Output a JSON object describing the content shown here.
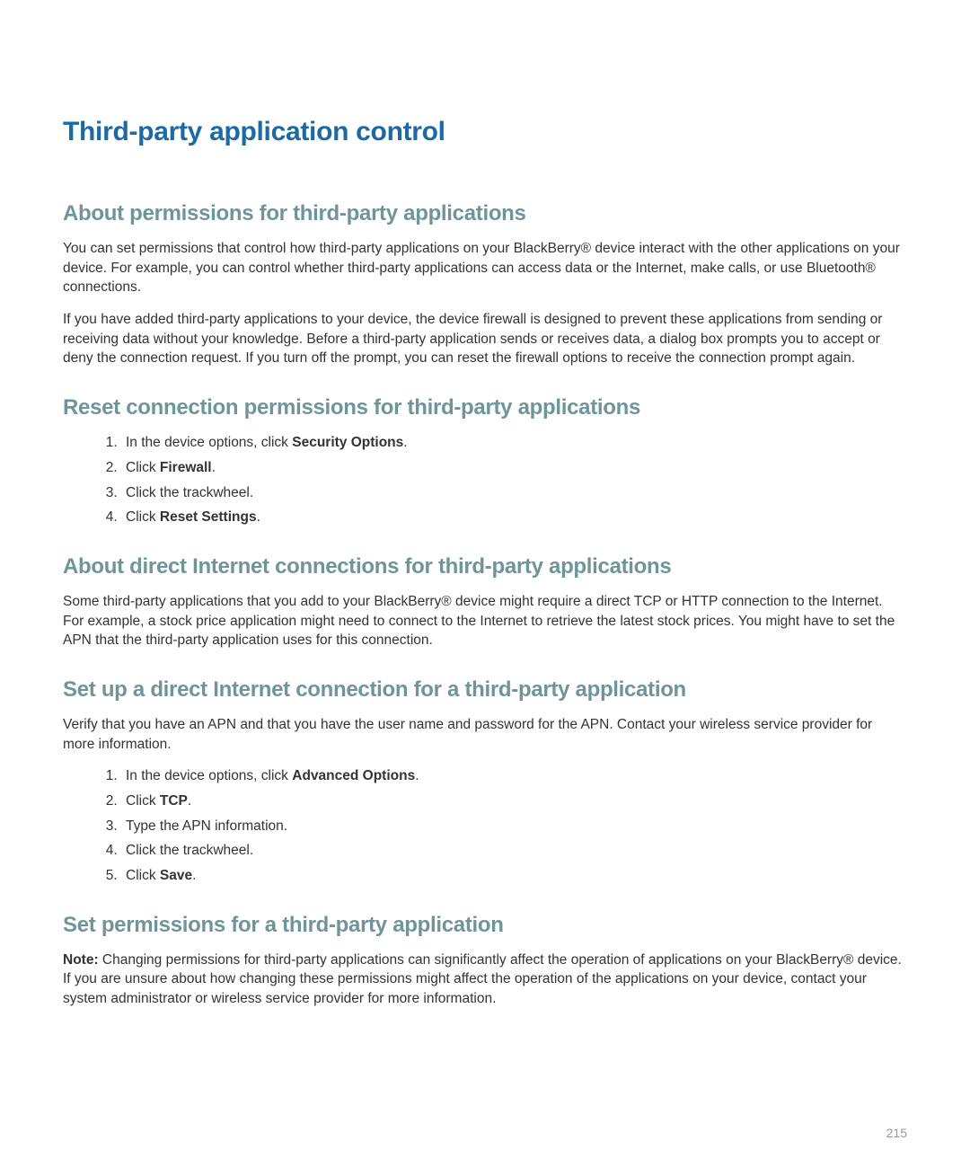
{
  "page": {
    "title": "Third-party application control",
    "pageNumber": "215"
  },
  "section1": {
    "heading": "About permissions for third-party applications",
    "para1": "You can set permissions that control how third-party applications on your BlackBerry® device interact with the other applications on your device. For example, you can control whether third-party applications can access data or the Internet, make calls, or use Bluetooth® connections.",
    "para2": "If you have added third-party applications to your device, the device firewall is designed to prevent these applications from sending or receiving data without your knowledge. Before a third-party application sends or receives data, a dialog box prompts you to accept or deny the connection request. If you turn off the prompt, you can reset the firewall options to receive the connection prompt again."
  },
  "section2": {
    "heading": "Reset connection permissions for third-party applications",
    "steps": [
      {
        "pre": "In the device options, click ",
        "bold": "Security Options",
        "post": "."
      },
      {
        "pre": "Click ",
        "bold": "Firewall",
        "post": "."
      },
      {
        "pre": "Click the trackwheel.",
        "bold": "",
        "post": ""
      },
      {
        "pre": "Click ",
        "bold": "Reset Settings",
        "post": "."
      }
    ]
  },
  "section3": {
    "heading": "About direct Internet connections for third-party applications",
    "para1": "Some third-party applications that you add to your BlackBerry® device might require a direct TCP or HTTP connection to the Internet. For example, a stock price application might need to connect to the Internet to retrieve the latest stock prices. You might have to set the APN that the third-party application uses for this connection."
  },
  "section4": {
    "heading": "Set up a direct Internet connection for a third-party application",
    "intro": "Verify that you have an APN and that you have the user name and password for the APN. Contact your wireless service provider for more information.",
    "steps": [
      {
        "pre": "In the device options, click ",
        "bold": "Advanced Options",
        "post": "."
      },
      {
        "pre": "Click ",
        "bold": "TCP",
        "post": "."
      },
      {
        "pre": "Type the APN information.",
        "bold": "",
        "post": ""
      },
      {
        "pre": "Click the trackwheel.",
        "bold": "",
        "post": ""
      },
      {
        "pre": "Click ",
        "bold": "Save",
        "post": "."
      }
    ]
  },
  "section5": {
    "heading": "Set permissions for a third-party application",
    "noteLabel": "Note:",
    "noteText": "  Changing permissions for third-party applications can significantly affect the operation of applications on your BlackBerry® device. If you are unsure about how changing these permissions might affect the operation of the applications on your device, contact your system administrator or wireless service provider for more information."
  }
}
